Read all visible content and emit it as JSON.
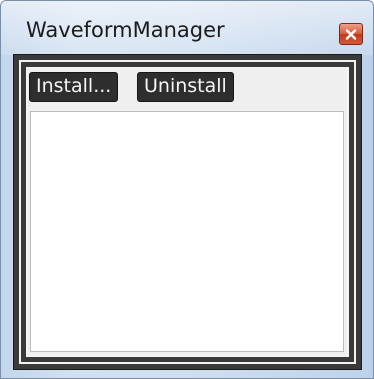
{
  "window": {
    "title": "WaveformManager",
    "close_icon": "close-icon"
  },
  "toolbar": {
    "install_label": "Install...",
    "uninstall_label": "Uninstall"
  },
  "list": {
    "items": []
  }
}
